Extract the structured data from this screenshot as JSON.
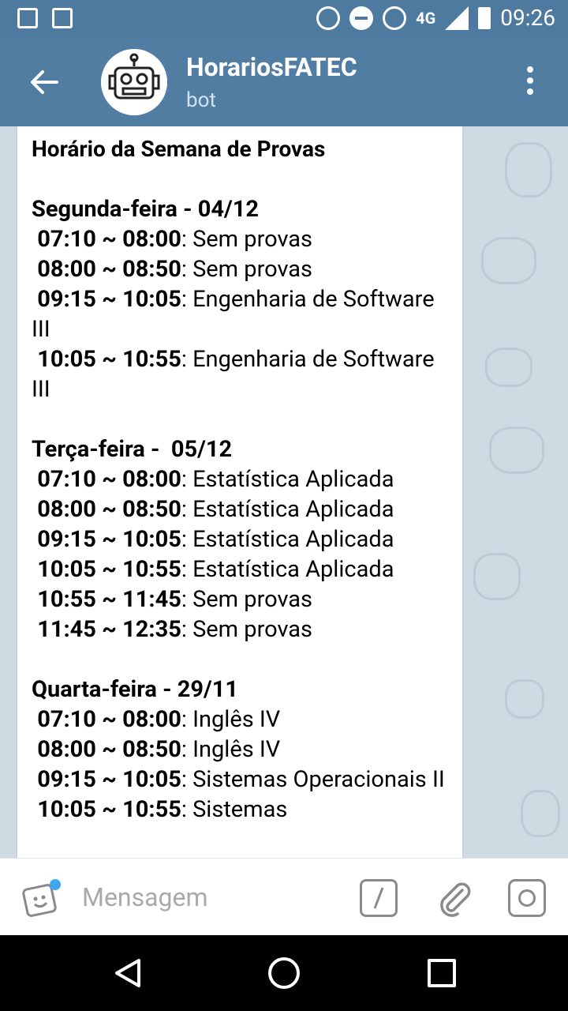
{
  "status_bar": {
    "time": "09:26",
    "network": "4G"
  },
  "header": {
    "title": "HorariosFATEC",
    "subtitle": "bot"
  },
  "message": {
    "title": "Horário da Semana de Provas",
    "days": [
      {
        "label": "Segunda-feira - 04/12",
        "entries": [
          {
            "time": "07:10 ~ 08:00",
            "text": ": Sem provas"
          },
          {
            "time": "08:00 ~ 08:50",
            "text": ": Sem provas"
          },
          {
            "time": "09:15 ~ 10:05",
            "text": ": Engenharia de Software III"
          },
          {
            "time": "10:05 ~ 10:55",
            "text": ": Engenharia de Software III"
          }
        ]
      },
      {
        "label": "Terça-feira -  05/12",
        "entries": [
          {
            "time": "07:10 ~ 08:00",
            "text": ": Estatística Aplicada"
          },
          {
            "time": "08:00 ~ 08:50",
            "text": ": Estatística Aplicada"
          },
          {
            "time": "09:15 ~ 10:05",
            "text": ": Estatística Aplicada"
          },
          {
            "time": "10:05 ~ 10:55",
            "text": ": Estatística Aplicada"
          },
          {
            "time": "10:55 ~ 11:45",
            "text": ": Sem provas"
          },
          {
            "time": "11:45 ~ 12:35",
            "text": ": Sem provas"
          }
        ]
      },
      {
        "label": "Quarta-feira - 29/11",
        "entries": [
          {
            "time": "07:10 ~ 08:00",
            "text": ": Inglês IV"
          },
          {
            "time": "08:00 ~ 08:50",
            "text": ": Inglês IV"
          },
          {
            "time": "09:15 ~ 10:05",
            "text": ": Sistemas Operacionais II"
          },
          {
            "time": "10:05 ~ 10:55",
            "text": ": Sistemas"
          }
        ]
      }
    ]
  },
  "input": {
    "placeholder": "Mensagem"
  },
  "colors": {
    "appbar": "#527da3",
    "statusbar": "#4e7aa0",
    "chat_bg": "#cfdbe3",
    "badge": "#3fa7ee"
  }
}
